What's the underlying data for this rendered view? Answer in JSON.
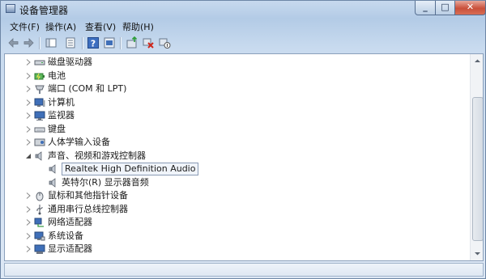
{
  "window": {
    "title": "设备管理器"
  },
  "menu": {
    "items": [
      "文件(F)",
      "操作(A)",
      "查看(V)",
      "帮助(H)"
    ]
  },
  "tree": {
    "items": [
      {
        "label": "磁盘驱动器",
        "icon": "disk-drive-icon",
        "expanded": false,
        "level": 1
      },
      {
        "label": "电池",
        "icon": "battery-icon",
        "expanded": false,
        "level": 1
      },
      {
        "label": "端口 (COM 和 LPT)",
        "icon": "port-icon",
        "expanded": false,
        "level": 1
      },
      {
        "label": "计算机",
        "icon": "computer-icon",
        "expanded": false,
        "level": 1
      },
      {
        "label": "监视器",
        "icon": "monitor-icon",
        "expanded": false,
        "level": 1
      },
      {
        "label": "键盘",
        "icon": "keyboard-icon",
        "expanded": false,
        "level": 1
      },
      {
        "label": "人体学输入设备",
        "icon": "hid-icon",
        "expanded": false,
        "level": 1
      },
      {
        "label": "声音、视频和游戏控制器",
        "icon": "speaker-icon",
        "expanded": true,
        "level": 1
      },
      {
        "label": "Realtek High Definition Audio",
        "icon": "speaker-icon",
        "level": 2,
        "selected": true
      },
      {
        "label": "英特尔(R) 显示器音频",
        "icon": "speaker-icon",
        "level": 2
      },
      {
        "label": "鼠标和其他指针设备",
        "icon": "mouse-icon",
        "expanded": false,
        "level": 1
      },
      {
        "label": "通用串行总线控制器",
        "icon": "usb-icon",
        "expanded": false,
        "level": 1
      },
      {
        "label": "网络适配器",
        "icon": "network-adapter-icon",
        "expanded": false,
        "level": 1
      },
      {
        "label": "系统设备",
        "icon": "system-device-icon",
        "expanded": false,
        "level": 1
      },
      {
        "label": "显示适配器",
        "icon": "display-adapter-icon",
        "expanded": false,
        "level": 1
      }
    ]
  }
}
